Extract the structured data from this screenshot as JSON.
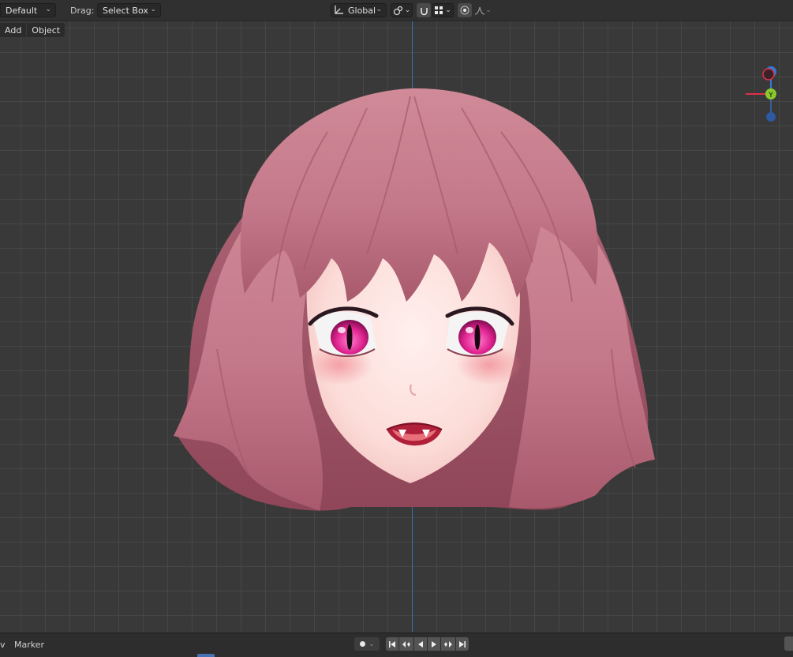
{
  "header": {
    "pivot_dropdown": "Default",
    "drag_label": "Drag:",
    "drag_value": "Select Box",
    "orientation_value": "Global",
    "icons": [
      "transform-orientation-icon",
      "transform-pivot-icon",
      "snap-icon",
      "snap-grid-icon",
      "proportional-edit-icon",
      "falloff-curve-icon"
    ]
  },
  "menu": {
    "add": "Add",
    "object": "Object"
  },
  "gizmo": {
    "z_label": "Z",
    "y_label": "Y",
    "x_color": "#e0304a",
    "y_color": "#8bc92d",
    "z_color": "#3479d6"
  },
  "timeline": {
    "view_partial": "v",
    "marker": "Marker",
    "buttons": [
      "jump-start",
      "jump-prev-keyframe",
      "play-reverse",
      "play",
      "jump-next-keyframe",
      "jump-end"
    ]
  },
  "colors": {
    "viewport_bg": "#393939",
    "grid_line": "#505050",
    "z_axis": "#3a6db4",
    "hair": "#c77a8a",
    "eye": "#e0238f"
  }
}
